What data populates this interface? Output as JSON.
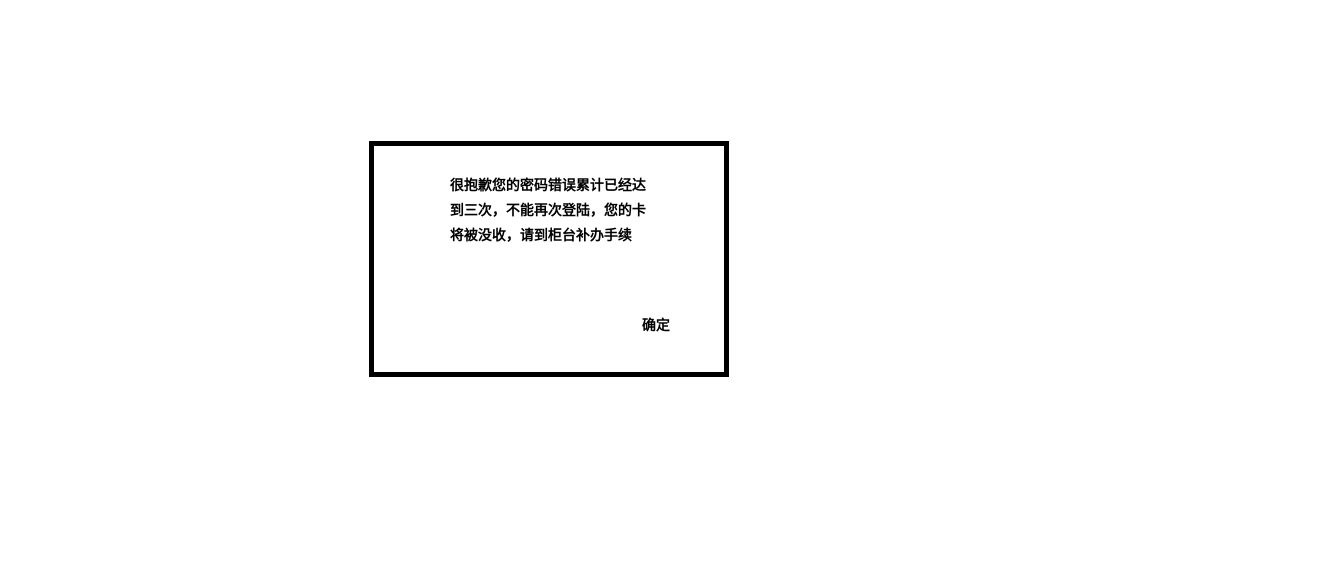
{
  "dialog": {
    "message_lines": [
      "很抱歉您的密码错误累计已经达",
      "到三次，不能再次登陆，您的卡",
      "将被没收，请到柜台补办手续"
    ],
    "ok_label": "确定"
  }
}
